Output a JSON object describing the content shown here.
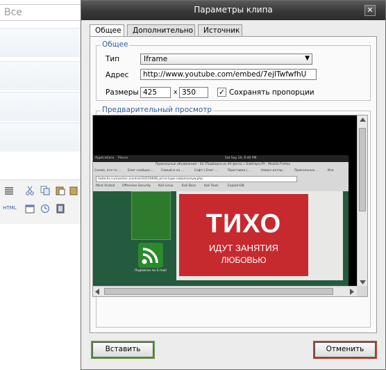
{
  "background": {
    "search_placeholder": "Все",
    "toolbar_html_label": "HTML"
  },
  "dialog": {
    "title": "Параметры клипа",
    "close_glyph": "✕",
    "tabs": [
      {
        "label": "Общее",
        "active": true
      },
      {
        "label": "Дополнительно",
        "active": false
      },
      {
        "label": "Источник",
        "active": false
      }
    ],
    "general": {
      "legend": "Общее",
      "type_label": "Тип",
      "type_value": "Iframe",
      "address_label": "Адрес",
      "address_value": "http://www.youtube.com/embed/7ejITwfwfhU",
      "sizes_label": "Размеры",
      "width_value": "425",
      "times": "x",
      "height_value": "350",
      "keep_ratio_label": "Сохранять пропорции",
      "keep_ratio_checked": true
    },
    "preview": {
      "legend": "Предварительный просмотр",
      "gnome_apps": "Applications",
      "gnome_places": "Places",
      "clock": "Sat Sep 26, 9:46 PM",
      "browser_title": "Прикольные объявления - 42 (Подборка из 40 фото) » БайНара.РУ - Mozilla Firefox",
      "tabs": [
        "Схема, кто-то ...",
        "Блог сообщес...",
        "Самый и на ...",
        "Софт | Блог ...",
        "Приставки | ...",
        "Новые интер...",
        "Прикольные ...",
        "Изо"
      ],
      "url": "hatechs.ru/nvector_icontrol/20150608_price-type-nekomamyw.php",
      "bookmarks": [
        "Most Visited",
        "Offensive Security",
        "Kali Linux",
        "Kali Docs",
        "Kali Tools",
        "Exploit-DB"
      ],
      "sign_big": "ТИХО",
      "sign_line1": "ИДУТ ЗАНЯТИЯ",
      "sign_line2": "ЛЮБОВЬЮ",
      "rss_caption": "Подписка по E-mail"
    },
    "insert_label": "Вставить",
    "cancel_label": "Отменить"
  }
}
